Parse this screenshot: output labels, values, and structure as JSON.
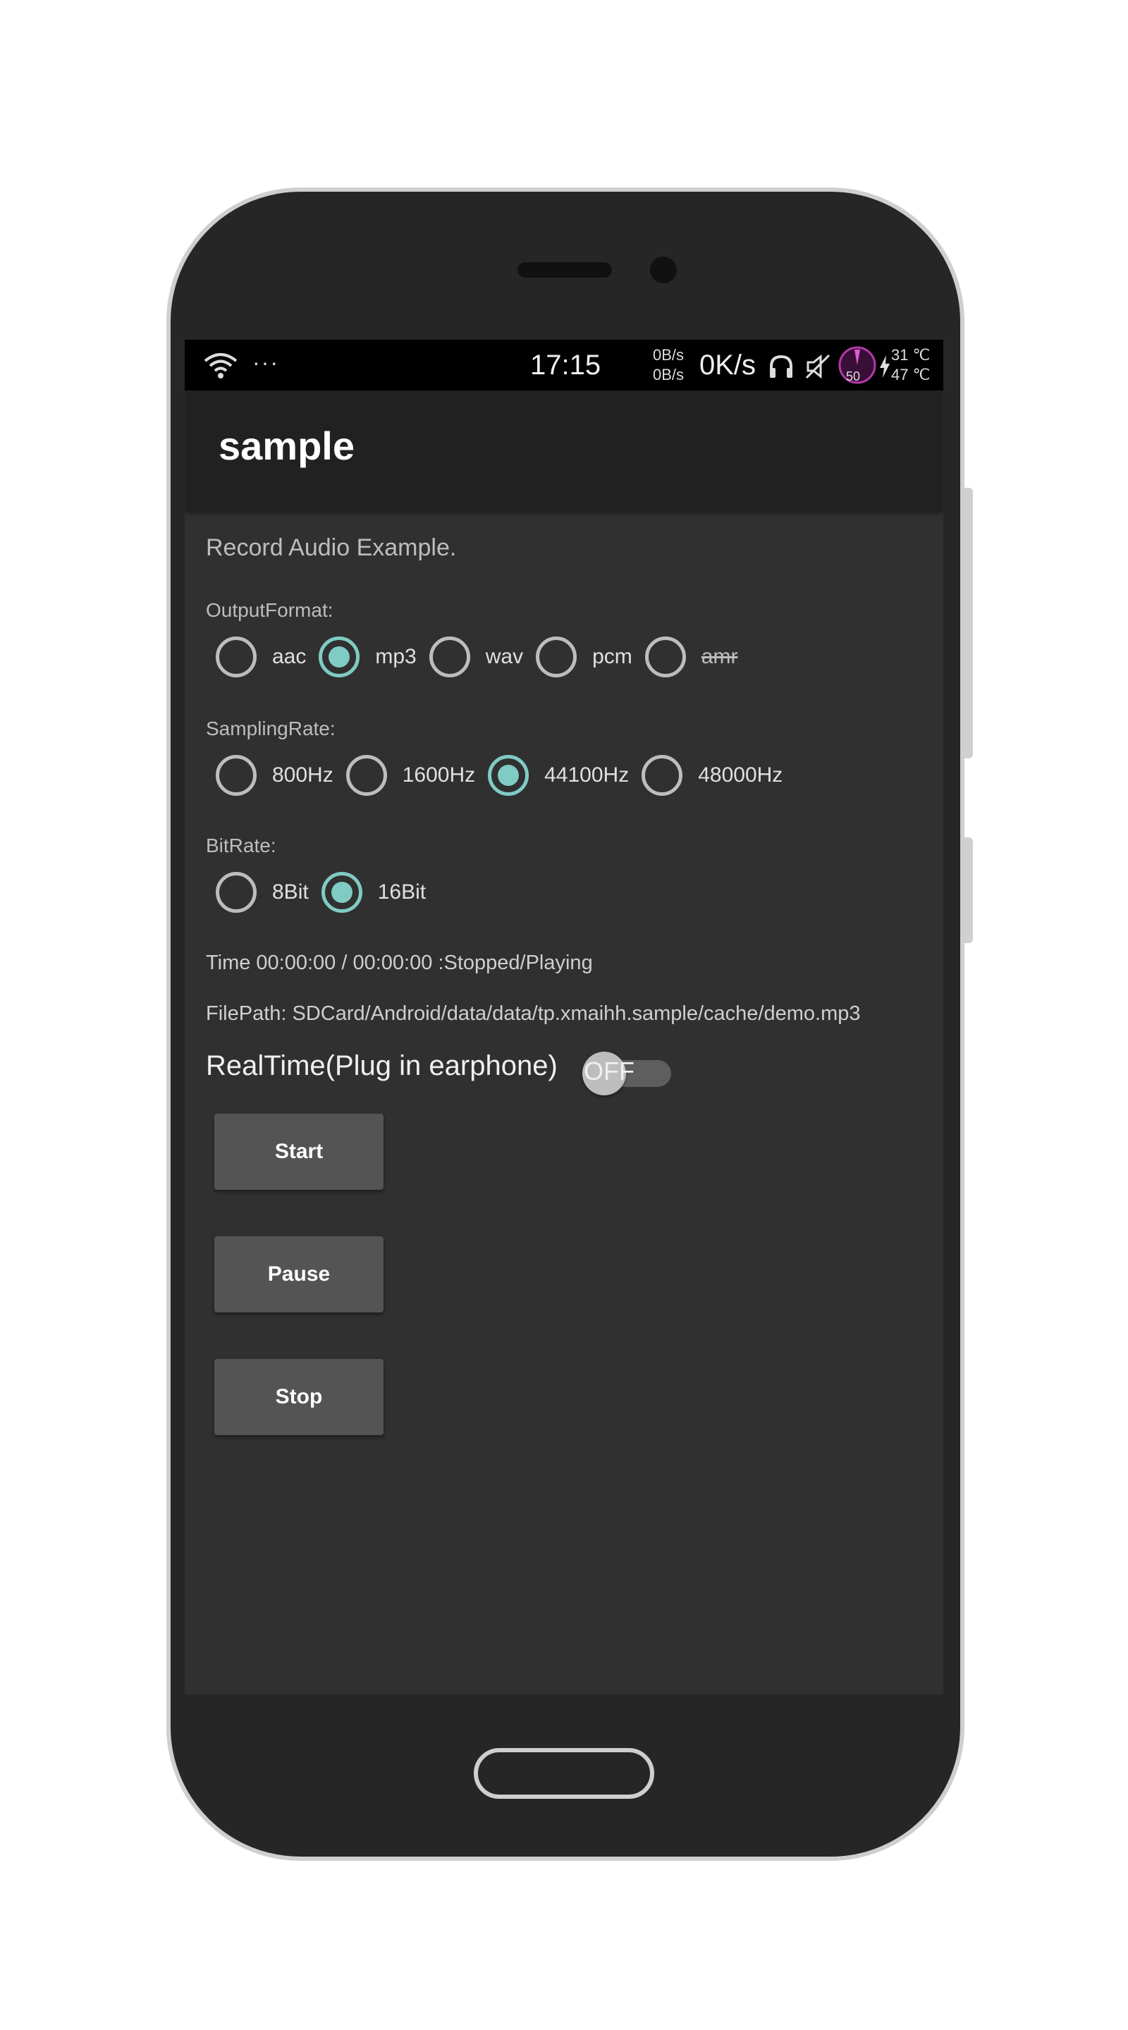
{
  "status_bar": {
    "time": "17:15",
    "net_up": "0B/s",
    "net_down": "0B/s",
    "net_speed": "0K/s",
    "gauge_value": "50",
    "temp_1": "31 ℃",
    "temp_2": "47 ℃",
    "dots": "···",
    "icons": [
      "wifi-icon",
      "headphones-icon",
      "mute-icon",
      "gauge-icon",
      "charging-icon"
    ]
  },
  "app_bar": {
    "title": "sample"
  },
  "main": {
    "heading": "Record Audio Example.",
    "output_format": {
      "label": "OutputFormat:",
      "options": [
        {
          "label": "aac",
          "checked": false
        },
        {
          "label": "mp3",
          "checked": true
        },
        {
          "label": "wav",
          "checked": false
        },
        {
          "label": "pcm",
          "checked": false
        },
        {
          "label": "amr",
          "checked": false,
          "disabled": true
        }
      ]
    },
    "sampling_rate": {
      "label": "SamplingRate:",
      "options": [
        {
          "label": "800Hz",
          "checked": false
        },
        {
          "label": "1600Hz",
          "checked": false
        },
        {
          "label": "44100Hz",
          "checked": true
        },
        {
          "label": "48000Hz",
          "checked": false
        }
      ]
    },
    "bit_rate": {
      "label": "BitRate:",
      "options": [
        {
          "label": "8Bit",
          "checked": false
        },
        {
          "label": "16Bit",
          "checked": true
        }
      ]
    },
    "time_status": "Time 00:00:00 / 00:00:00  :Stopped/Playing",
    "file_path": "FilePath: SDCard/Android/data/data/tp.xmaihh.sample/cache/demo.mp3",
    "realtime_label": "RealTime(Plug in earphone)",
    "realtime_switch": {
      "text": "OFF",
      "on": false
    },
    "buttons": {
      "start": "Start",
      "pause": "Pause",
      "stop": "Stop"
    }
  },
  "colors": {
    "accent": "#80cbc4",
    "background": "#303030",
    "app_bar": "#212121",
    "status_bar": "#000000",
    "button": "#545454"
  }
}
